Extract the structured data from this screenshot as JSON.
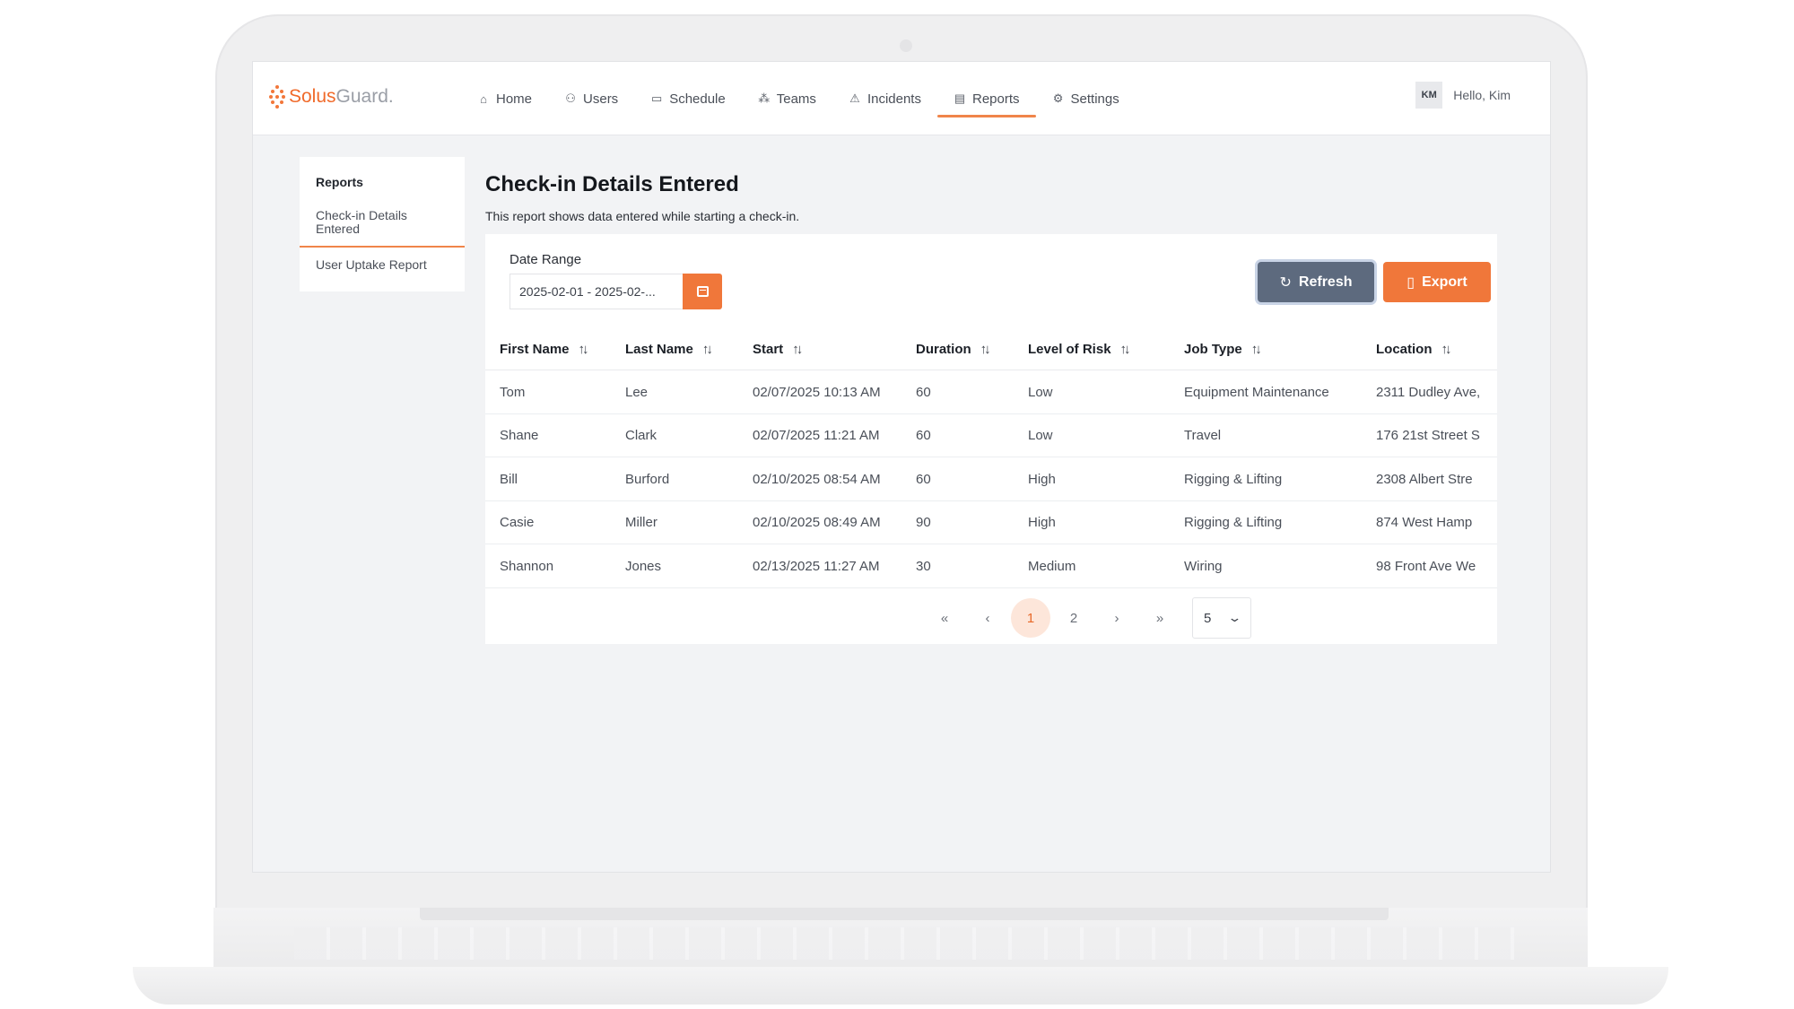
{
  "brand": {
    "name_a": "Solus",
    "name_b": "Guard."
  },
  "nav": [
    {
      "label": "Home",
      "icon": "⌂"
    },
    {
      "label": "Users",
      "icon": "⚇"
    },
    {
      "label": "Schedule",
      "icon": "▭"
    },
    {
      "label": "Teams",
      "icon": "⁂"
    },
    {
      "label": "Incidents",
      "icon": "⚠"
    },
    {
      "label": "Reports",
      "icon": "▤",
      "active": true
    },
    {
      "label": "Settings",
      "icon": "⚙"
    }
  ],
  "user": {
    "initials": "KM",
    "greeting": "Hello, Kim"
  },
  "sidebar": {
    "title": "Reports",
    "items": [
      {
        "label": "Check-in Details Entered",
        "active": true
      },
      {
        "label": "User Uptake Report"
      }
    ]
  },
  "page": {
    "title": "Check-in Details Entered",
    "description": "This report shows data entered while starting a check-in."
  },
  "filters": {
    "date_range_label": "Date Range",
    "date_range_value": "2025-02-01 - 2025-02-..."
  },
  "actions": {
    "refresh_label": "Refresh",
    "export_label": "Export"
  },
  "table": {
    "columns": [
      "First Name",
      "Last Name",
      "Start",
      "Duration",
      "Level of Risk",
      "Job Type",
      "Location"
    ],
    "rows": [
      [
        "Tom",
        "Lee",
        "02/07/2025 10:13 AM",
        "60",
        "Low",
        "Equipment Maintenance",
        "2311 Dudley Ave,"
      ],
      [
        "Shane",
        "Clark",
        "02/07/2025 11:21 AM",
        "60",
        "Low",
        "Travel",
        "176 21st Street S"
      ],
      [
        "Bill",
        "Burford",
        "02/10/2025 08:54 AM",
        "60",
        "High",
        "Rigging & Lifting",
        "2308 Albert Stre"
      ],
      [
        "Casie",
        "Miller",
        "02/10/2025 08:49 AM",
        "90",
        "High",
        "Rigging & Lifting",
        "874 West Hamp"
      ],
      [
        "Shannon",
        "Jones",
        "02/13/2025 11:27 AM",
        "30",
        "Medium",
        "Wiring",
        "98 Front Ave We"
      ]
    ]
  },
  "pagination": {
    "first": "«",
    "prev": "‹",
    "pages": [
      "1",
      "2"
    ],
    "current": "1",
    "next": "›",
    "last": "»",
    "per_page": "5"
  },
  "colors": {
    "accent": "#f0773a",
    "refresh": "#5d6a7e"
  }
}
